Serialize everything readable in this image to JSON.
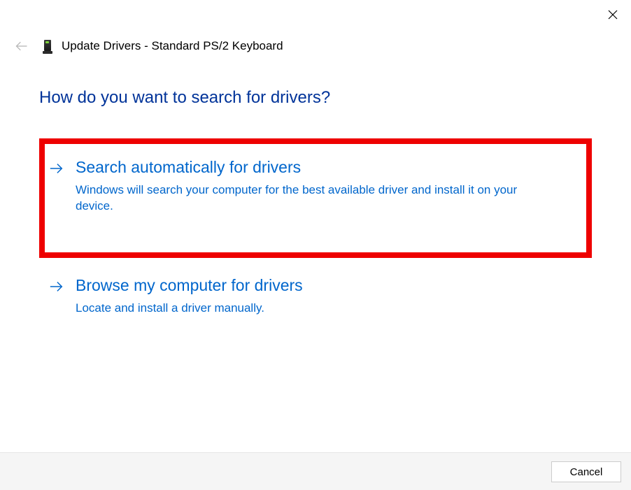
{
  "window": {
    "title": "Update Drivers - Standard PS/2 Keyboard"
  },
  "question": "How do you want to search for drivers?",
  "options": [
    {
      "title": "Search automatically for drivers",
      "description": "Windows will search your computer for the best available driver and install it on your device."
    },
    {
      "title": "Browse my computer for drivers",
      "description": "Locate and install a driver manually."
    }
  ],
  "footer": {
    "cancel_label": "Cancel"
  },
  "colors": {
    "accent": "#0066cc",
    "heading": "#003399",
    "highlight_border": "#ee0000"
  }
}
